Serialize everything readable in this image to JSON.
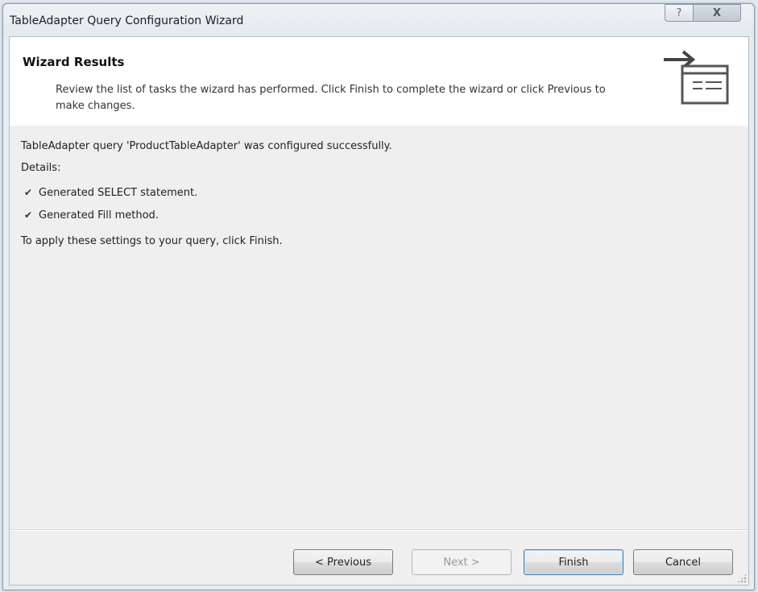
{
  "window": {
    "title": "TableAdapter Query Configuration Wizard",
    "help_glyph": "?",
    "close_glyph": "X"
  },
  "header": {
    "title": "Wizard Results",
    "description": "Review the list of tasks the wizard has performed. Click Finish to complete the wizard or click Previous to make changes.",
    "icon": "wizard-arrow-list-icon"
  },
  "results": {
    "status": "TableAdapter query 'ProductTableAdapter' was configured successfully.",
    "details_label": "Details:",
    "tasks": [
      {
        "icon": "checkmark-icon",
        "label": "Generated SELECT statement."
      },
      {
        "icon": "checkmark-icon",
        "label": "Generated Fill method."
      }
    ],
    "apply_text": "To apply these settings to your query, click Finish."
  },
  "buttons": {
    "previous": "< Previous",
    "next": "Next >",
    "finish": "Finish",
    "cancel": "Cancel"
  },
  "colors": {
    "header_bg": "#ffffff",
    "body_bg": "#efefef",
    "titlebar_bg": "#e6ecf1",
    "default_button_border": "#3c7fb1"
  }
}
